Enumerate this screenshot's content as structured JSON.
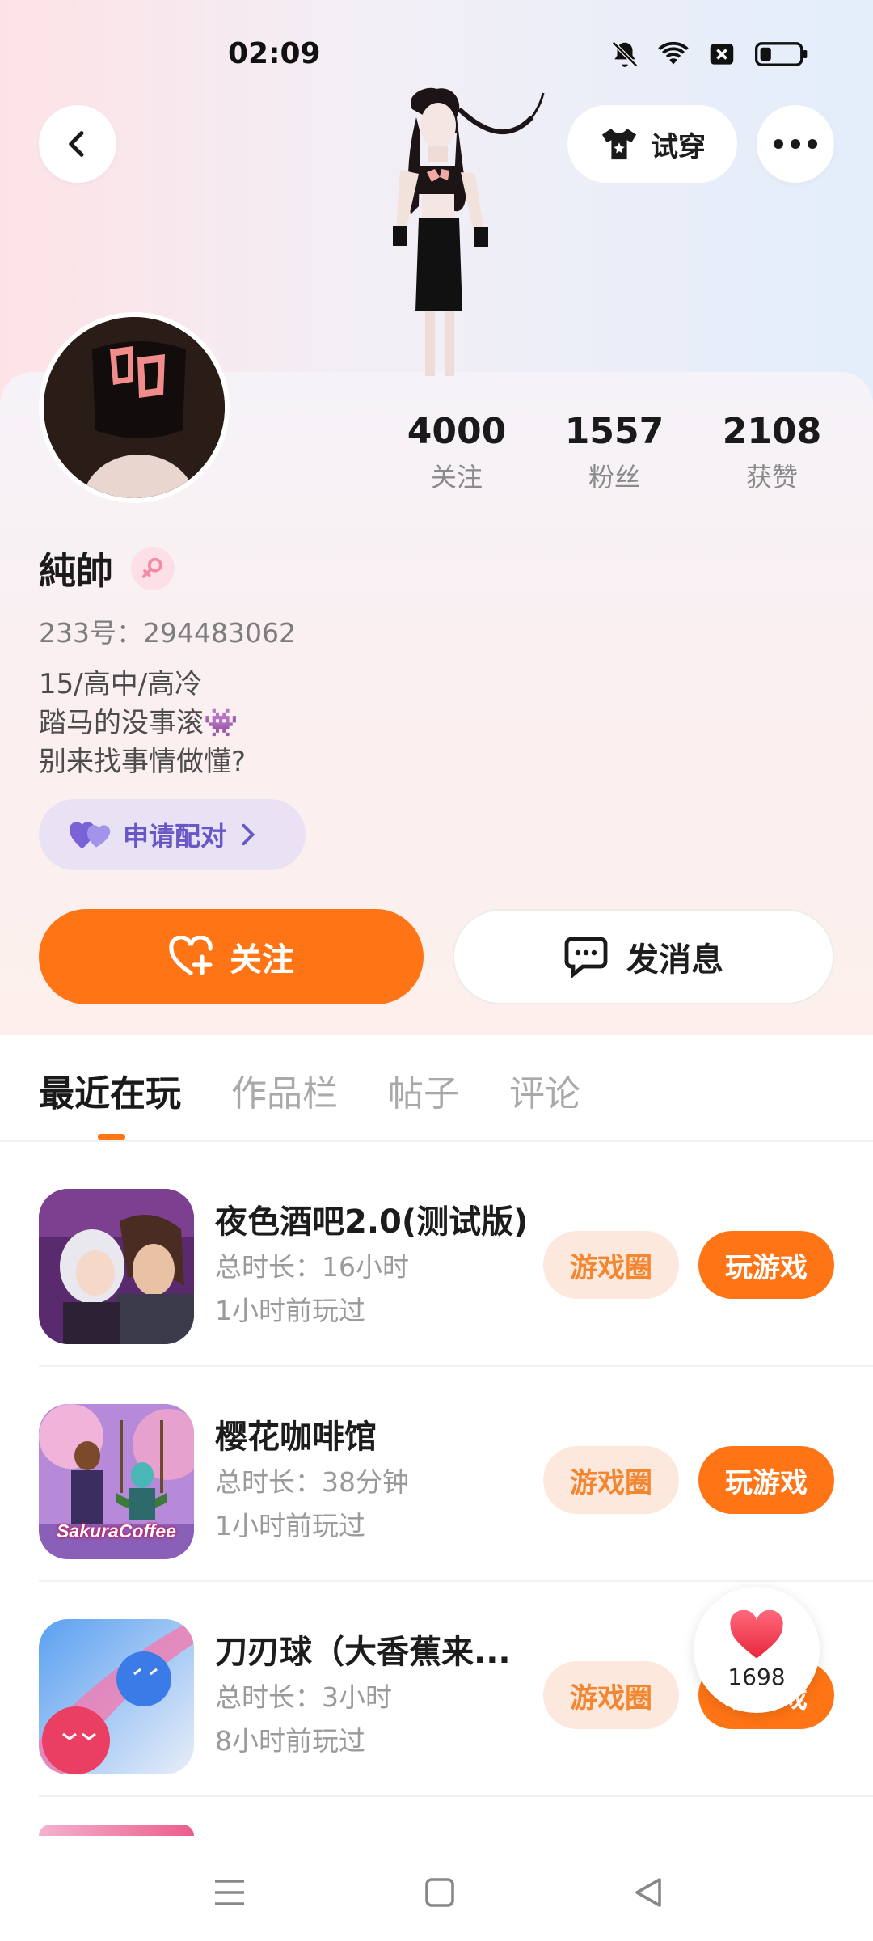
{
  "status_bar": {
    "time": "02:09",
    "icons": [
      "bell-off-icon",
      "wifi-icon",
      "sim-off-icon",
      "battery-icon"
    ]
  },
  "header": {
    "back_icon": "chevron-left-icon",
    "tryon_label": "试穿",
    "more_icon": "ellipsis-icon"
  },
  "profile": {
    "name": "純帥",
    "gender": "female",
    "uid": "233号：294483062",
    "bio": [
      "15/高中/高冷",
      "踏马的没事滚👾",
      "别来找事情做懂?"
    ],
    "match_label": "申请配对",
    "stats": [
      {
        "num": "4000",
        "label": "关注"
      },
      {
        "num": "1557",
        "label": "粉丝"
      },
      {
        "num": "2108",
        "label": "获赞"
      }
    ]
  },
  "actions": {
    "follow_label": "关注",
    "message_label": "发消息"
  },
  "tabs": [
    "最近在玩",
    "作品栏",
    "帖子",
    "评论"
  ],
  "games": [
    {
      "title": "夜色酒吧2.0(测试版)",
      "duration": "总时长：16小时",
      "last_played": "1小时前玩过",
      "circle_label": "游戏圈",
      "play_label": "玩游戏"
    },
    {
      "title": "樱花咖啡馆",
      "duration": "总时长：38分钟",
      "last_played": "1小时前玩过",
      "circle_label": "游戏圈",
      "play_label": "玩游戏"
    },
    {
      "title": "刀刃球（大香蕉来...",
      "duration": "总时长：3小时",
      "last_played": "8小时前玩过",
      "circle_label": "游戏圈",
      "play_label": "玩游戏"
    }
  ],
  "thumb_text": {
    "sakura": "SakuraCoffee"
  },
  "like_float": {
    "count": "1698"
  },
  "colors": {
    "accent": "#ff7415",
    "accent_light": "#fde8dd",
    "match_purple": "#6a57c5"
  }
}
